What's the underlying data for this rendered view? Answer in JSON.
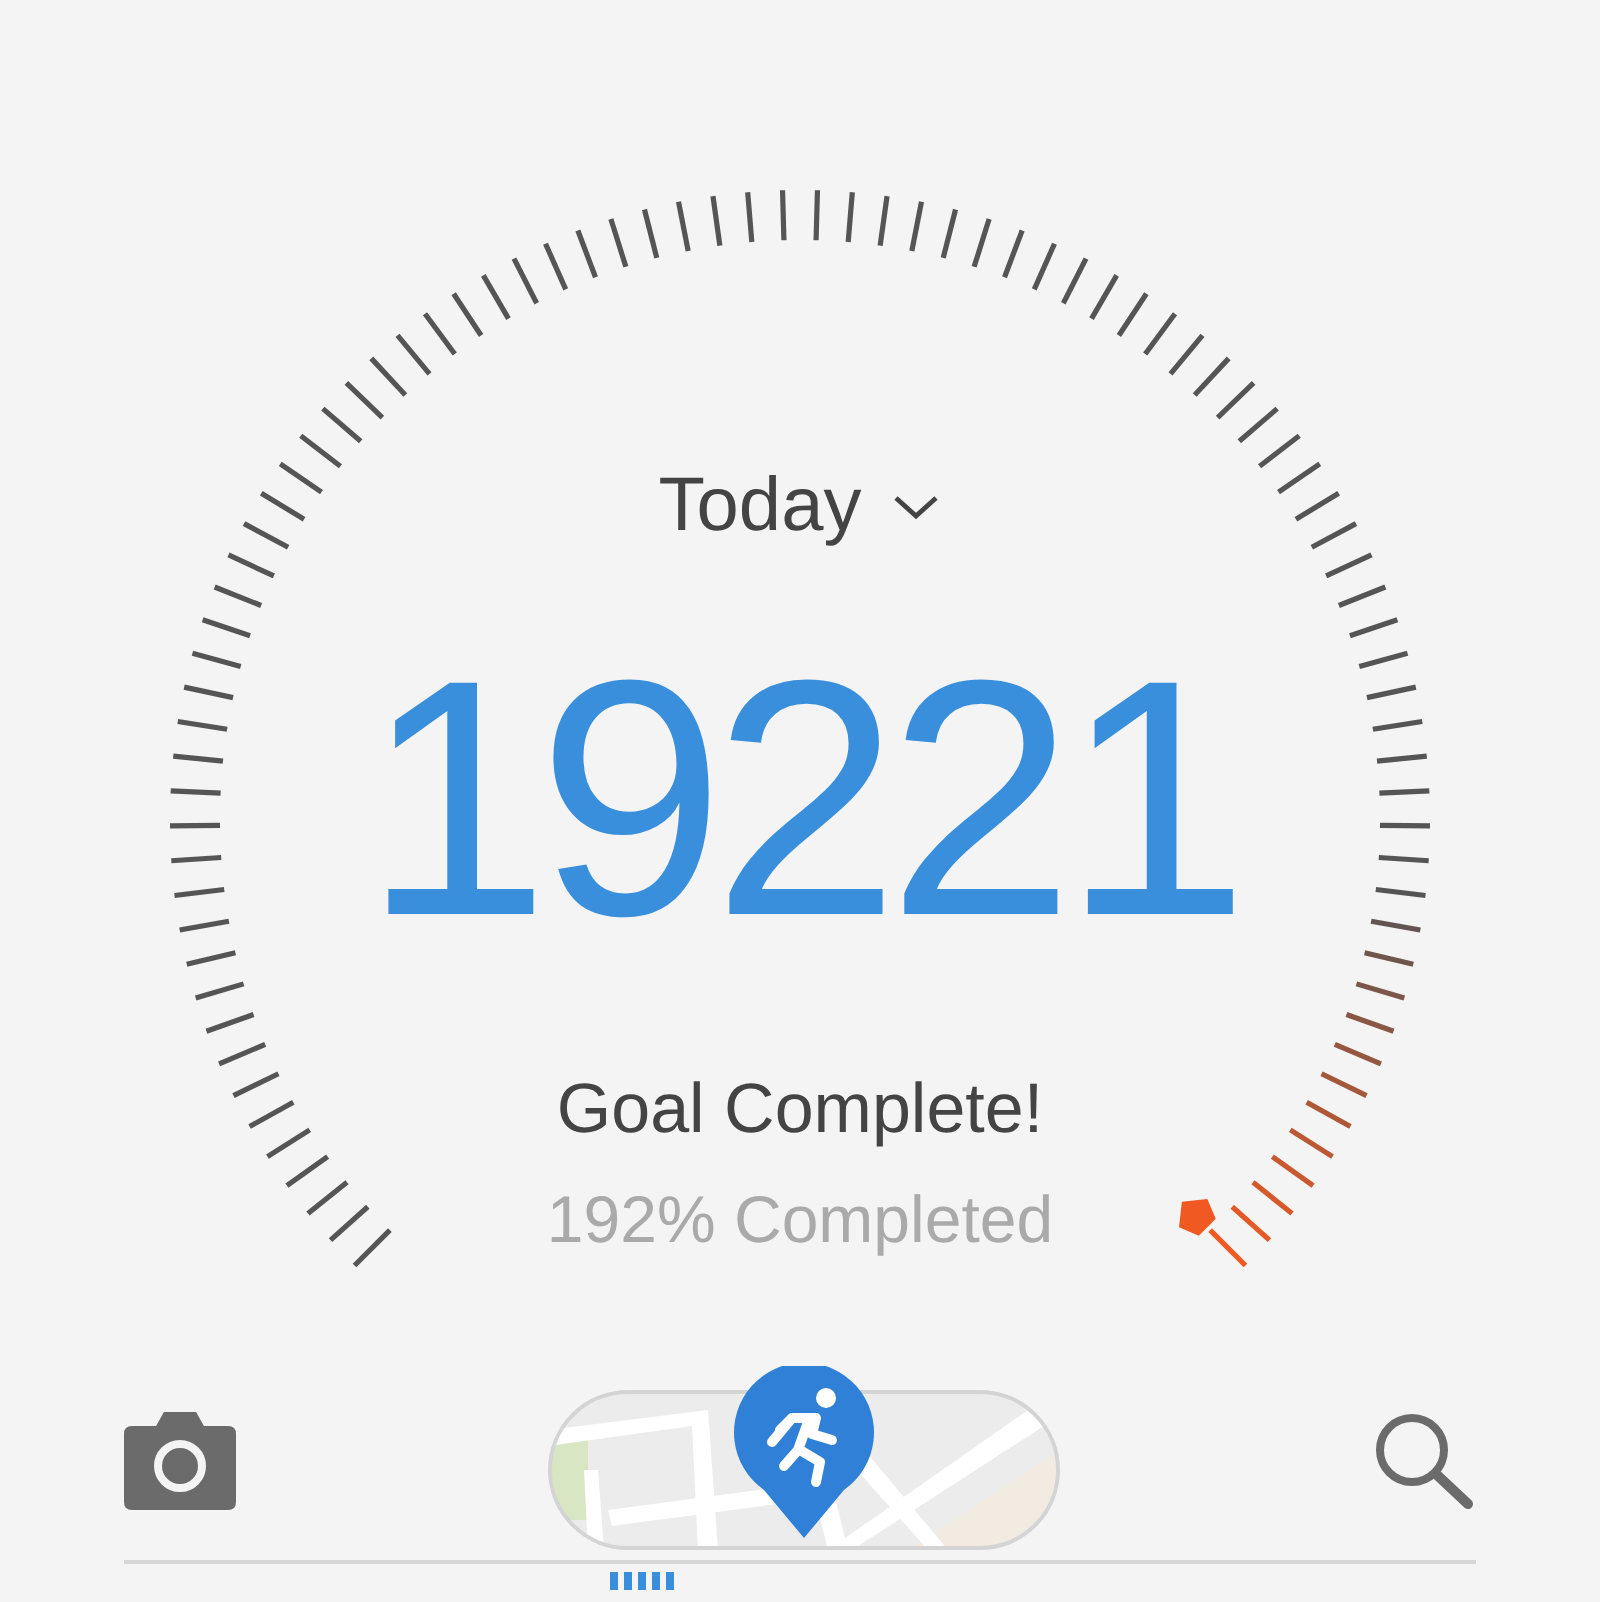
{
  "gauge": {
    "period": "Today",
    "steps": "19221",
    "status": "Goal Complete!",
    "percent": "192% Completed"
  }
}
